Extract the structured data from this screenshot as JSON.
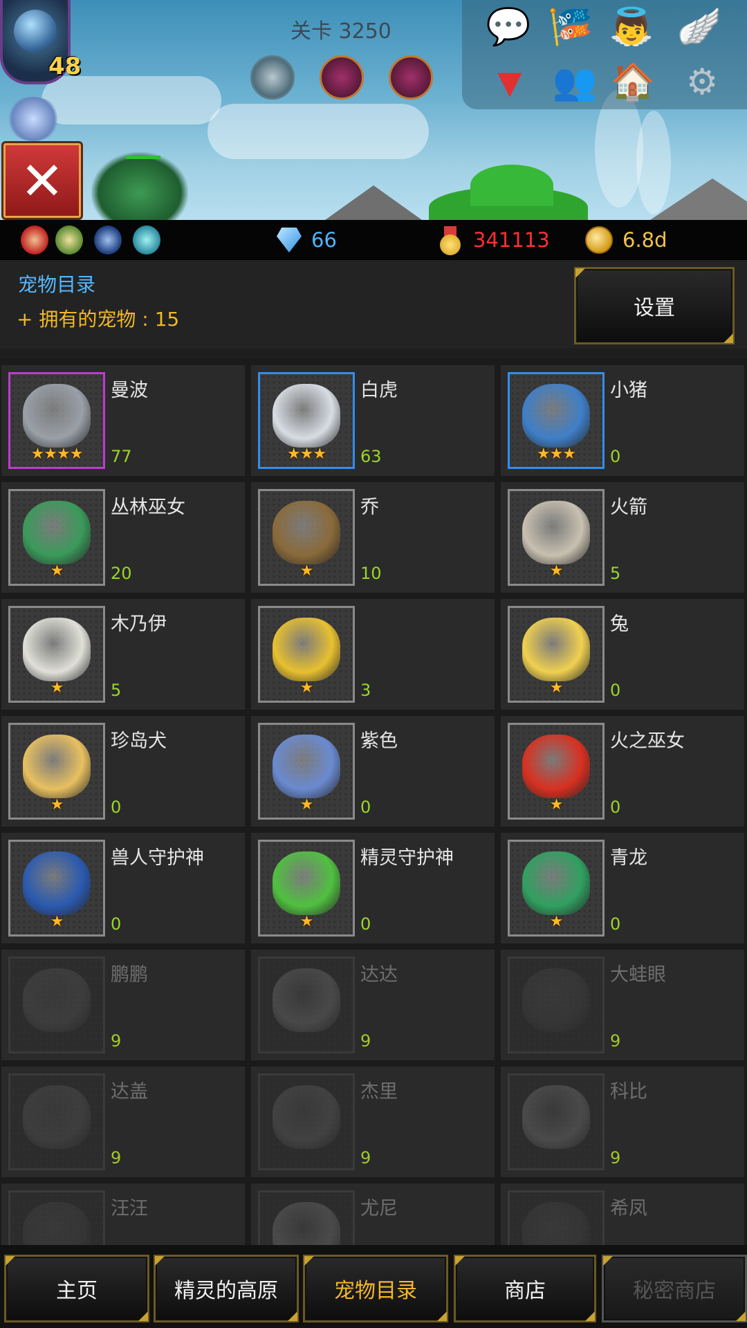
{
  "top": {
    "stage_label": "关卡 3250",
    "boss_level": "48"
  },
  "top_menu": [
    {
      "name": "chat-icon",
      "glyph": "💬"
    },
    {
      "name": "event-banner-icon",
      "glyph": "🎏"
    },
    {
      "name": "angel-icon",
      "glyph": "👼"
    },
    {
      "name": "wings-icon",
      "glyph": "🪽"
    },
    {
      "name": "dropdown-arrow-icon",
      "glyph": "▼"
    },
    {
      "name": "friends-icon",
      "glyph": "👥"
    },
    {
      "name": "mailbox-icon",
      "glyph": "🏠"
    },
    {
      "name": "settings-gear-icon",
      "glyph": "⚙"
    }
  ],
  "resources": {
    "gems": "66",
    "medals": "341113",
    "gold": "6.8d"
  },
  "header": {
    "title": "宠物目录",
    "owned": "+ 拥有的宠物 : 15",
    "settings_label": "设置"
  },
  "pets": [
    {
      "name": "曼波",
      "count": "77",
      "stars": "★★★★",
      "rarity": "purple",
      "locked": false,
      "color": "#9aa0a8"
    },
    {
      "name": "白虎",
      "count": "63",
      "stars": "★★★",
      "rarity": "blue",
      "locked": false,
      "color": "#d8dde4"
    },
    {
      "name": "小猪",
      "count": "0",
      "stars": "★★★",
      "rarity": "blue",
      "locked": false,
      "color": "#3f7fc8"
    },
    {
      "name": "丛林巫女",
      "count": "20",
      "stars": "★",
      "rarity": "gray",
      "locked": false,
      "color": "#3a9a5a"
    },
    {
      "name": "乔",
      "count": "10",
      "stars": "★",
      "rarity": "gray",
      "locked": false,
      "color": "#8a6a3a"
    },
    {
      "name": "火箭",
      "count": "5",
      "stars": "★",
      "rarity": "gray",
      "locked": false,
      "color": "#c8c0b0"
    },
    {
      "name": "木乃伊",
      "count": "5",
      "stars": "★",
      "rarity": "gray",
      "locked": false,
      "color": "#e0e0d8"
    },
    {
      "name": "",
      "count": "3",
      "stars": "★",
      "rarity": "gray",
      "locked": false,
      "color": "#e8c030"
    },
    {
      "name": "兔",
      "count": "0",
      "stars": "★",
      "rarity": "gray",
      "locked": false,
      "color": "#f0d050"
    },
    {
      "name": "珍岛犬",
      "count": "0",
      "stars": "★",
      "rarity": "gray",
      "locked": false,
      "color": "#e8c060"
    },
    {
      "name": "紫色",
      "count": "0",
      "stars": "★",
      "rarity": "gray",
      "locked": false,
      "color": "#6a8ad0"
    },
    {
      "name": "火之巫女",
      "count": "0",
      "stars": "★",
      "rarity": "gray",
      "locked": false,
      "color": "#d83020"
    },
    {
      "name": "兽人守护神",
      "count": "0",
      "stars": "★",
      "rarity": "gray",
      "locked": false,
      "color": "#2a5ab0"
    },
    {
      "name": "精灵守护神",
      "count": "0",
      "stars": "★",
      "rarity": "gray",
      "locked": false,
      "color": "#50c040"
    },
    {
      "name": "青龙",
      "count": "0",
      "stars": "★",
      "rarity": "gray",
      "locked": false,
      "color": "#30a060"
    },
    {
      "name": "鹏鹏",
      "count": "9",
      "stars": "",
      "rarity": "gray",
      "locked": true,
      "color": "#6a8ad0"
    },
    {
      "name": "达达",
      "count": "9",
      "stars": "",
      "rarity": "gray",
      "locked": true,
      "color": "#c8c8c8"
    },
    {
      "name": "大蛙眼",
      "count": "9",
      "stars": "",
      "rarity": "gray",
      "locked": true,
      "color": "#8050a0"
    },
    {
      "name": "达盖",
      "count": "9",
      "stars": "",
      "rarity": "gray",
      "locked": true,
      "color": "#50a050"
    },
    {
      "name": "杰里",
      "count": "9",
      "stars": "",
      "rarity": "gray",
      "locked": true,
      "color": "#c0a040"
    },
    {
      "name": "科比",
      "count": "9",
      "stars": "",
      "rarity": "gray",
      "locked": true,
      "color": "#d0d0d0"
    },
    {
      "name": "汪汪",
      "count": "",
      "stars": "",
      "rarity": "gray",
      "locked": true,
      "color": "#a05030"
    },
    {
      "name": "尤尼",
      "count": "",
      "stars": "",
      "rarity": "gray",
      "locked": true,
      "color": "#d0d0d0"
    },
    {
      "name": "希凤",
      "count": "",
      "stars": "",
      "rarity": "gray",
      "locked": true,
      "color": "#c04040"
    }
  ],
  "nav": [
    {
      "label": "主页",
      "state": "normal"
    },
    {
      "label": "精灵的高原",
      "state": "normal"
    },
    {
      "label": "宠物目录",
      "state": "active"
    },
    {
      "label": "商店",
      "state": "normal"
    },
    {
      "label": "秘密商店",
      "state": "disabled"
    }
  ]
}
